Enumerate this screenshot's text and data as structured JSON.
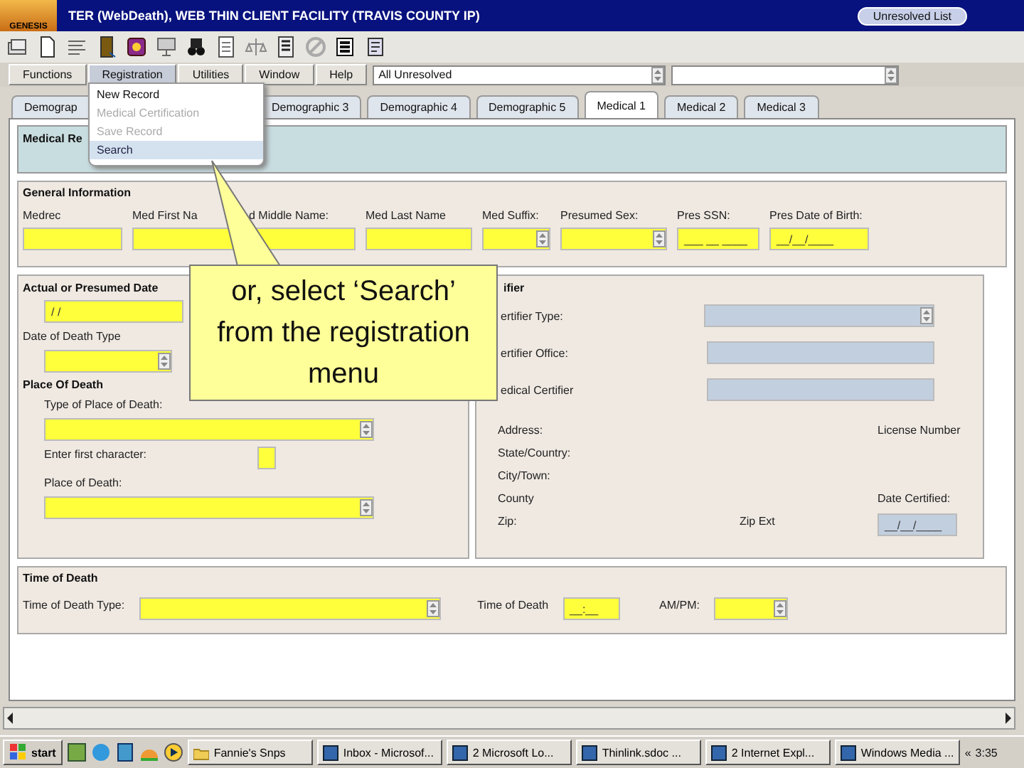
{
  "window": {
    "title": "TER (WebDeath), WEB THIN CLIENT FACILITY (TRAVIS COUNTY IP)",
    "unresolved_button": "Unresolved List"
  },
  "logo": {
    "text": "GENESIS"
  },
  "menu_bar": [
    {
      "label": "Functions",
      "selected": false
    },
    {
      "label": "Registration",
      "selected": true
    },
    {
      "label": "Utilities",
      "selected": false
    },
    {
      "label": "Window",
      "selected": false
    },
    {
      "label": "Help",
      "selected": false
    }
  ],
  "record_filter": {
    "value": "All Unresolved"
  },
  "dropdown": [
    {
      "label": "New Record",
      "disabled": false,
      "selected": false
    },
    {
      "label": "Medical Certification",
      "disabled": true,
      "selected": false
    },
    {
      "label": "Save Record",
      "disabled": true,
      "selected": false
    },
    {
      "label": "Search",
      "disabled": false,
      "selected": true
    }
  ],
  "tabs": [
    {
      "label": "Demograp",
      "selected": false
    },
    {
      "label": "Demographic 3",
      "selected": false
    },
    {
      "label": "Demographic 4",
      "selected": false
    },
    {
      "label": "Demographic 5",
      "selected": false
    },
    {
      "label": "Medical 1",
      "selected": true
    },
    {
      "label": "Medical 2",
      "selected": false
    },
    {
      "label": "Medical 3",
      "selected": false
    }
  ],
  "medical_record": {
    "title": "Medical Re"
  },
  "general_information": {
    "title": "General Information",
    "fields": [
      {
        "label": "Medrec",
        "kind": "text",
        "disabled": false
      },
      {
        "label": "Med First Na",
        "kind": "text",
        "disabled": false
      },
      {
        "label": "d Middle Name:",
        "kind": "text",
        "disabled": false
      },
      {
        "label": "Med Last Name",
        "kind": "text",
        "disabled": false
      },
      {
        "label": "Med Suffix:",
        "kind": "select",
        "disabled": false
      },
      {
        "label": "Presumed Sex:",
        "kind": "select",
        "disabled": false
      },
      {
        "label": "Pres SSN:",
        "kind": "text",
        "disabled": false,
        "value": "___ __ ____"
      },
      {
        "label": "Pres Date of Birth:",
        "kind": "text",
        "disabled": false,
        "value": "__/__/____"
      }
    ]
  },
  "date_of_death": {
    "title": "Actual or Presumed Date",
    "date": {
      "kind": "text",
      "disabled": false,
      "value": "/  /"
    },
    "type_label": "Date of Death Type",
    "type": {
      "kind": "select",
      "disabled": false
    }
  },
  "place_of_death": {
    "title": "Place Of Death",
    "type_label": "Type of Place of Death:",
    "type": {
      "kind": "select",
      "disabled": false
    },
    "first_char_label": "Enter first character:",
    "first_char": {
      "kind": "text",
      "disabled": false
    },
    "place_label": "Place of Death:",
    "place": {
      "kind": "select",
      "disabled": false
    }
  },
  "certifier": {
    "title": "ifier",
    "fields": [
      {
        "label": "ertifier Type:",
        "kind": "select",
        "disabled": true
      },
      {
        "label": "ertifier Office:",
        "kind": "text",
        "disabled": true
      },
      {
        "label": "edical Certifier",
        "kind": "text",
        "disabled": true
      }
    ],
    "address_labels": [
      "Address:",
      "State/Country:",
      "City/Town:",
      "County",
      "Zip:"
    ],
    "license_label": "License Number",
    "zip_ext_label": "Zip Ext",
    "date_certified_label": "Date Certified:",
    "date_certified": {
      "kind": "text",
      "disabled": true,
      "value": "__/__/____"
    }
  },
  "time_of_death": {
    "title": "Time of Death",
    "type_label": "Time of Death Type:",
    "type": {
      "kind": "select",
      "disabled": false
    },
    "time_label": "Time of Death",
    "time": {
      "kind": "text",
      "disabled": false,
      "value": "__:__"
    },
    "ampm_label": "AM/PM:",
    "ampm": {
      "kind": "select",
      "disabled": false
    }
  },
  "callout": {
    "text": "or, select ‘Search’ from the registration menu"
  },
  "taskbar": {
    "start": "start",
    "tasks": [
      "Fannie's Snps",
      "Inbox - Microsof...",
      "2 Microsoft Lo...",
      "Thinlink.sdoc ...",
      "2 Internet Expl...",
      "Windows Media ..."
    ],
    "tray_arrow": "«",
    "clock": "3:35"
  }
}
